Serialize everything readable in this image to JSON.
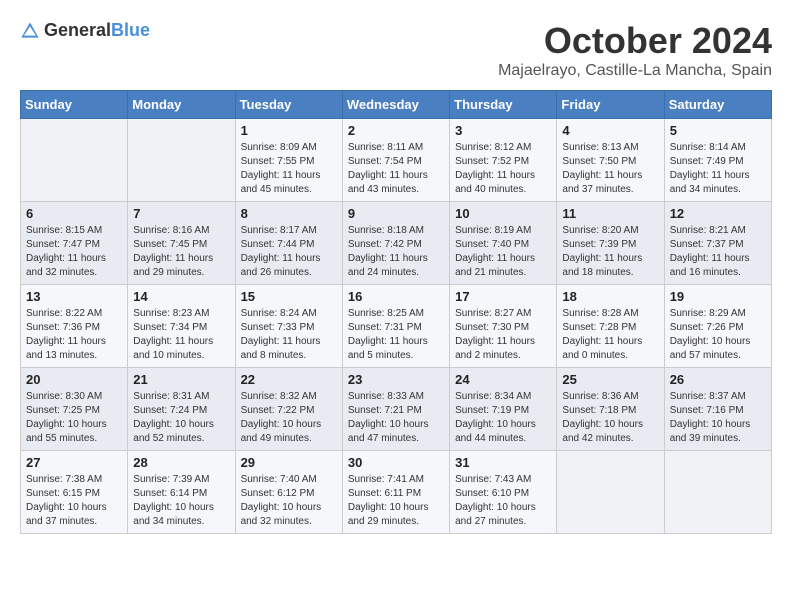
{
  "header": {
    "logo": {
      "text_general": "General",
      "text_blue": "Blue"
    },
    "month_title": "October 2024",
    "location": "Majaelrayo, Castille-La Mancha, Spain"
  },
  "weekdays": [
    "Sunday",
    "Monday",
    "Tuesday",
    "Wednesday",
    "Thursday",
    "Friday",
    "Saturday"
  ],
  "weeks": [
    [
      {
        "day": "",
        "info": ""
      },
      {
        "day": "",
        "info": ""
      },
      {
        "day": "1",
        "info": "Sunrise: 8:09 AM\nSunset: 7:55 PM\nDaylight: 11 hours and 45 minutes."
      },
      {
        "day": "2",
        "info": "Sunrise: 8:11 AM\nSunset: 7:54 PM\nDaylight: 11 hours and 43 minutes."
      },
      {
        "day": "3",
        "info": "Sunrise: 8:12 AM\nSunset: 7:52 PM\nDaylight: 11 hours and 40 minutes."
      },
      {
        "day": "4",
        "info": "Sunrise: 8:13 AM\nSunset: 7:50 PM\nDaylight: 11 hours and 37 minutes."
      },
      {
        "day": "5",
        "info": "Sunrise: 8:14 AM\nSunset: 7:49 PM\nDaylight: 11 hours and 34 minutes."
      }
    ],
    [
      {
        "day": "6",
        "info": "Sunrise: 8:15 AM\nSunset: 7:47 PM\nDaylight: 11 hours and 32 minutes."
      },
      {
        "day": "7",
        "info": "Sunrise: 8:16 AM\nSunset: 7:45 PM\nDaylight: 11 hours and 29 minutes."
      },
      {
        "day": "8",
        "info": "Sunrise: 8:17 AM\nSunset: 7:44 PM\nDaylight: 11 hours and 26 minutes."
      },
      {
        "day": "9",
        "info": "Sunrise: 8:18 AM\nSunset: 7:42 PM\nDaylight: 11 hours and 24 minutes."
      },
      {
        "day": "10",
        "info": "Sunrise: 8:19 AM\nSunset: 7:40 PM\nDaylight: 11 hours and 21 minutes."
      },
      {
        "day": "11",
        "info": "Sunrise: 8:20 AM\nSunset: 7:39 PM\nDaylight: 11 hours and 18 minutes."
      },
      {
        "day": "12",
        "info": "Sunrise: 8:21 AM\nSunset: 7:37 PM\nDaylight: 11 hours and 16 minutes."
      }
    ],
    [
      {
        "day": "13",
        "info": "Sunrise: 8:22 AM\nSunset: 7:36 PM\nDaylight: 11 hours and 13 minutes."
      },
      {
        "day": "14",
        "info": "Sunrise: 8:23 AM\nSunset: 7:34 PM\nDaylight: 11 hours and 10 minutes."
      },
      {
        "day": "15",
        "info": "Sunrise: 8:24 AM\nSunset: 7:33 PM\nDaylight: 11 hours and 8 minutes."
      },
      {
        "day": "16",
        "info": "Sunrise: 8:25 AM\nSunset: 7:31 PM\nDaylight: 11 hours and 5 minutes."
      },
      {
        "day": "17",
        "info": "Sunrise: 8:27 AM\nSunset: 7:30 PM\nDaylight: 11 hours and 2 minutes."
      },
      {
        "day": "18",
        "info": "Sunrise: 8:28 AM\nSunset: 7:28 PM\nDaylight: 11 hours and 0 minutes."
      },
      {
        "day": "19",
        "info": "Sunrise: 8:29 AM\nSunset: 7:26 PM\nDaylight: 10 hours and 57 minutes."
      }
    ],
    [
      {
        "day": "20",
        "info": "Sunrise: 8:30 AM\nSunset: 7:25 PM\nDaylight: 10 hours and 55 minutes."
      },
      {
        "day": "21",
        "info": "Sunrise: 8:31 AM\nSunset: 7:24 PM\nDaylight: 10 hours and 52 minutes."
      },
      {
        "day": "22",
        "info": "Sunrise: 8:32 AM\nSunset: 7:22 PM\nDaylight: 10 hours and 49 minutes."
      },
      {
        "day": "23",
        "info": "Sunrise: 8:33 AM\nSunset: 7:21 PM\nDaylight: 10 hours and 47 minutes."
      },
      {
        "day": "24",
        "info": "Sunrise: 8:34 AM\nSunset: 7:19 PM\nDaylight: 10 hours and 44 minutes."
      },
      {
        "day": "25",
        "info": "Sunrise: 8:36 AM\nSunset: 7:18 PM\nDaylight: 10 hours and 42 minutes."
      },
      {
        "day": "26",
        "info": "Sunrise: 8:37 AM\nSunset: 7:16 PM\nDaylight: 10 hours and 39 minutes."
      }
    ],
    [
      {
        "day": "27",
        "info": "Sunrise: 7:38 AM\nSunset: 6:15 PM\nDaylight: 10 hours and 37 minutes."
      },
      {
        "day": "28",
        "info": "Sunrise: 7:39 AM\nSunset: 6:14 PM\nDaylight: 10 hours and 34 minutes."
      },
      {
        "day": "29",
        "info": "Sunrise: 7:40 AM\nSunset: 6:12 PM\nDaylight: 10 hours and 32 minutes."
      },
      {
        "day": "30",
        "info": "Sunrise: 7:41 AM\nSunset: 6:11 PM\nDaylight: 10 hours and 29 minutes."
      },
      {
        "day": "31",
        "info": "Sunrise: 7:43 AM\nSunset: 6:10 PM\nDaylight: 10 hours and 27 minutes."
      },
      {
        "day": "",
        "info": ""
      },
      {
        "day": "",
        "info": ""
      }
    ]
  ]
}
